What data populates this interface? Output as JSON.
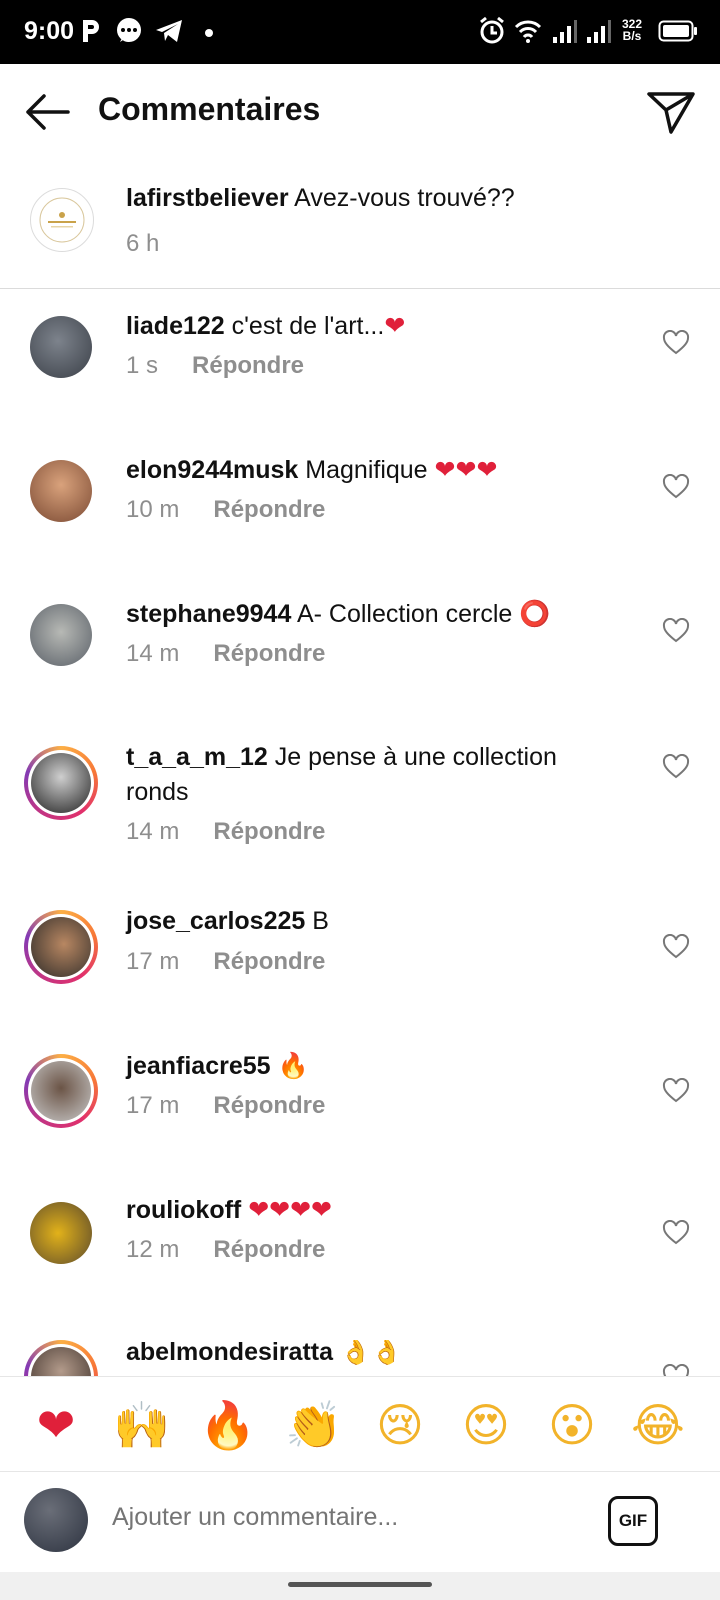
{
  "status_bar": {
    "time": "9:00",
    "net_speed_value": "322",
    "net_speed_unit": "B/s"
  },
  "header": {
    "title": "Commentaires"
  },
  "caption": {
    "username": "lafirstbeliever",
    "text": "Avez-vous trouvé??",
    "time": "6 h"
  },
  "comments": [
    {
      "username": "liade122",
      "text": "c'est de l'art...",
      "emoji": "❤",
      "time": "1 s",
      "reply": "Répondre"
    },
    {
      "username": "elon9244musk",
      "text": "Magnifique",
      "emoji": "❤❤❤",
      "time": "10 m",
      "reply": "Répondre"
    },
    {
      "username": "stephane9944",
      "text": "A- Collection cercle",
      "emoji": "⭕",
      "time": "14 m",
      "reply": "Répondre"
    },
    {
      "username": "t_a_a_m_12",
      "text": "Je pense à une collection ronds",
      "emoji": "",
      "time": "14 m",
      "reply": "Répondre"
    },
    {
      "username": "jose_carlos225",
      "text": "B",
      "emoji": "",
      "time": "17 m",
      "reply": "Répondre"
    },
    {
      "username": "jeanfiacre55",
      "text": "",
      "emoji": "🔥",
      "time": "17 m",
      "reply": "Répondre"
    },
    {
      "username": "rouliokoff",
      "text": "",
      "emoji": "❤❤❤❤",
      "time": "12 m",
      "reply": "Répondre"
    },
    {
      "username": "abelmondesiratta",
      "text": "",
      "emoji": "👌👌",
      "time": "",
      "reply": ""
    }
  ],
  "reactions": [
    "❤",
    "🙌",
    "🔥",
    "👏",
    "😢",
    "😍",
    "😮",
    "😂"
  ],
  "composer": {
    "placeholder": "Ajouter un commentaire...",
    "gif_label": "GIF"
  },
  "colors": {
    "secondary_text": "#8e8e8e",
    "heart_red": "#e0203a",
    "story_ring": "#e1306c"
  }
}
